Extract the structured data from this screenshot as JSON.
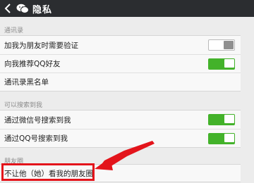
{
  "header": {
    "title": "隐私"
  },
  "sections": [
    {
      "label": "通讯录",
      "rows": [
        {
          "label": "加我为朋友时需要验证",
          "toggle": "off"
        },
        {
          "label": "向我推荐QQ好友",
          "toggle": "on"
        },
        {
          "label": "通讯录黑名单",
          "toggle": null
        }
      ]
    },
    {
      "label": "可以搜索到我",
      "rows": [
        {
          "label": "通过微信号搜索到我",
          "toggle": "on"
        },
        {
          "label": "通过QQ号搜索到我",
          "toggle": "on"
        }
      ]
    },
    {
      "label": "朋友圈",
      "rows": [
        {
          "label": "不让他（她）看我的朋友圈",
          "toggle": null
        }
      ]
    }
  ],
  "colors": {
    "header_bg": "#2b2d30",
    "toggle_on": "#43b22a",
    "annotation": "#e3141b"
  }
}
